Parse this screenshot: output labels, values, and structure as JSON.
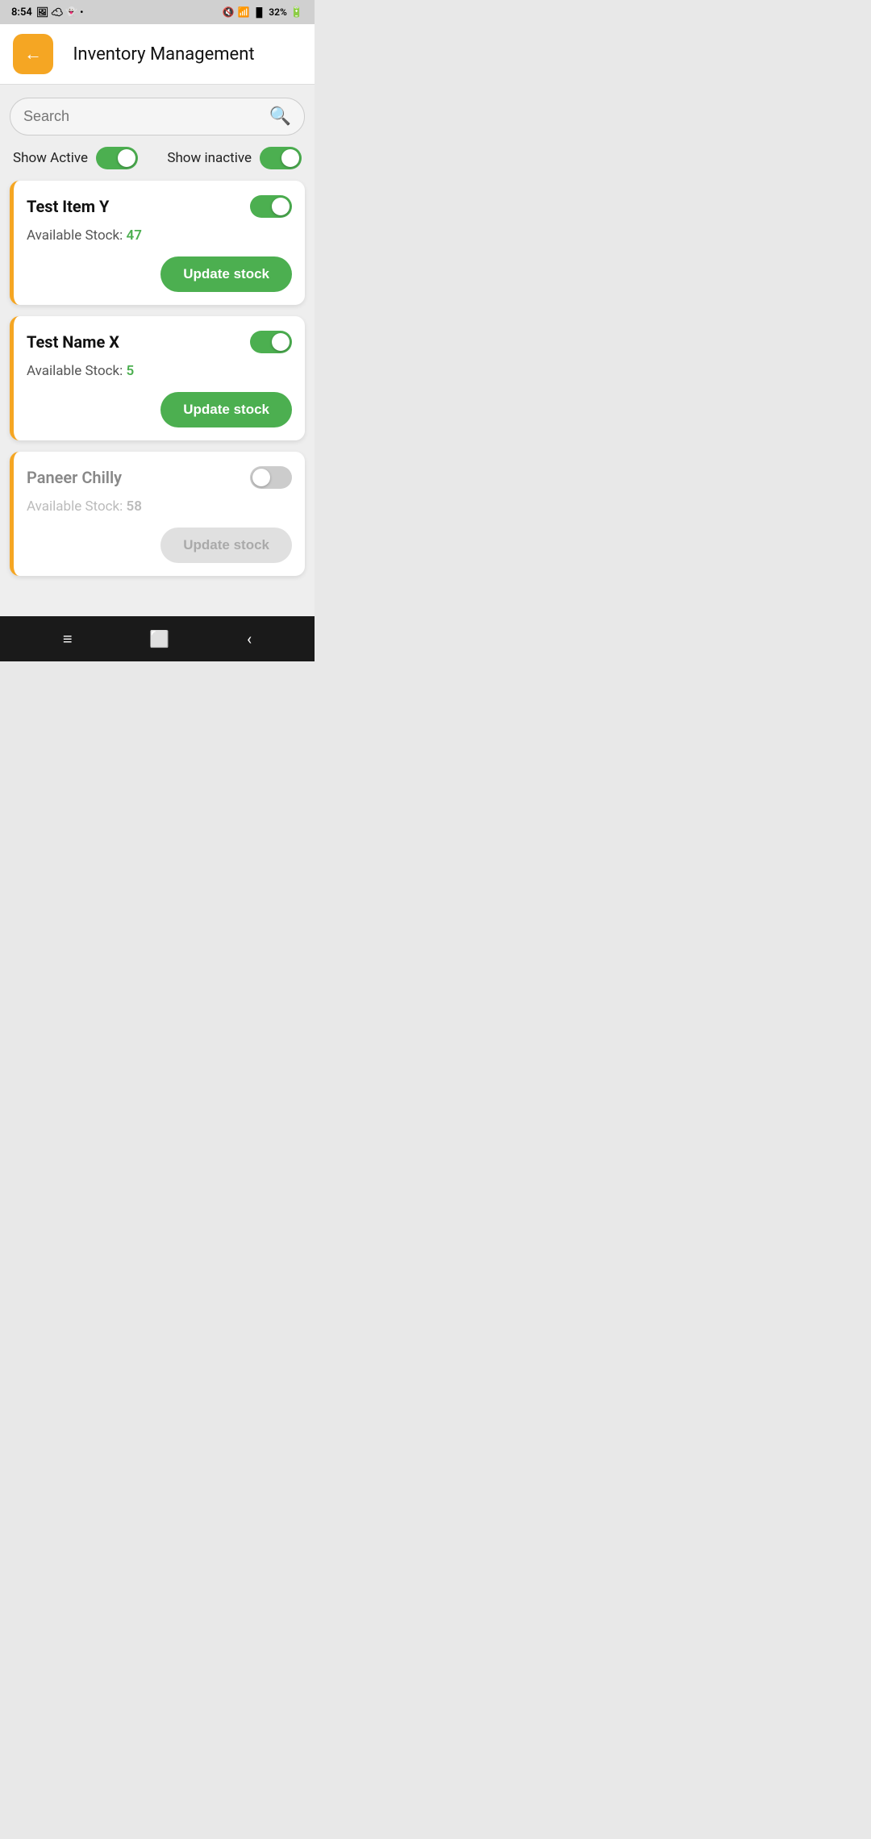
{
  "statusBar": {
    "time": "8:54",
    "battery": "32%"
  },
  "header": {
    "backLabel": "←",
    "title": "Inventory Management"
  },
  "search": {
    "placeholder": "Search"
  },
  "filters": {
    "showActiveLabel": "Show Active",
    "showActiveOn": true,
    "showInactiveLabel": "Show inactive",
    "showInactiveOn": true
  },
  "items": [
    {
      "name": "Test Item Y",
      "active": true,
      "stockLabel": "Available Stock:",
      "stockValue": "47",
      "updateLabel": "Update stock"
    },
    {
      "name": "Test Name X",
      "active": true,
      "stockLabel": "Available Stock:",
      "stockValue": "5",
      "updateLabel": "Update stock"
    },
    {
      "name": "Paneer Chilly",
      "active": false,
      "stockLabel": "Available Stock:",
      "stockValue": "58",
      "updateLabel": "Update stock"
    }
  ],
  "colors": {
    "accent": "#F5A623",
    "green": "#4CAF50",
    "inactiveGray": "#ccc"
  }
}
